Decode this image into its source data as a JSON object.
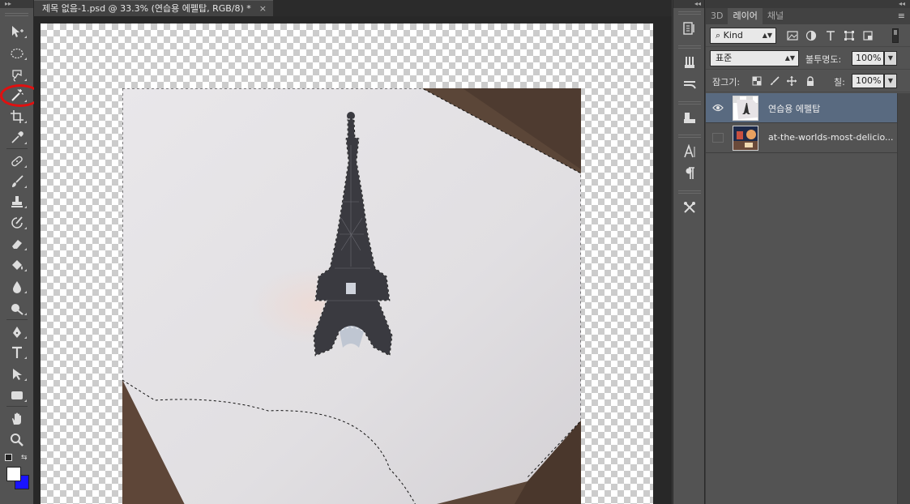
{
  "document": {
    "tab_title": "제목 없음-1.psd @ 33.3% (연습용 에펠탑, RGB/8) *",
    "close_glyph": "×"
  },
  "toolbar": {
    "collapse_glyph": "▸▸",
    "tools": [
      {
        "id": "move",
        "icon": "move-icon"
      },
      {
        "id": "marquee",
        "icon": "elliptical-marquee-icon"
      },
      {
        "id": "lasso",
        "icon": "lasso-icon"
      },
      {
        "id": "magic-wand",
        "icon": "magic-wand-icon",
        "highlighted": true,
        "highlight_color": "#e01010"
      },
      {
        "id": "crop",
        "icon": "crop-icon"
      },
      {
        "id": "eyedropper",
        "icon": "eyedropper-icon"
      },
      {
        "id": "healing",
        "icon": "healing-brush-icon"
      },
      {
        "id": "brush",
        "icon": "brush-icon"
      },
      {
        "id": "stamp",
        "icon": "clone-stamp-icon"
      },
      {
        "id": "history-brush",
        "icon": "history-brush-icon"
      },
      {
        "id": "eraser",
        "icon": "eraser-icon"
      },
      {
        "id": "paint-bucket",
        "icon": "paint-bucket-icon"
      },
      {
        "id": "blur",
        "icon": "blur-icon"
      },
      {
        "id": "dodge",
        "icon": "dodge-icon"
      },
      {
        "id": "pen",
        "icon": "pen-icon"
      },
      {
        "id": "type",
        "icon": "type-icon"
      },
      {
        "id": "path-select",
        "icon": "path-selection-icon"
      },
      {
        "id": "shape",
        "icon": "rectangle-shape-icon"
      },
      {
        "id": "hand",
        "icon": "hand-icon"
      },
      {
        "id": "zoom",
        "icon": "zoom-icon"
      }
    ],
    "foreground_color": "#ffffff",
    "background_color": "#1a14ff"
  },
  "panel": {
    "collapse_glyph": "◂◂",
    "tabs": [
      "3D",
      "레이어",
      "채널"
    ],
    "active_tab": "레이어",
    "menu_glyph": "≡",
    "filter_kind": "Kind",
    "blend_mode": "표준",
    "opacity_label": "불투명도:",
    "opacity_value": "100%",
    "lock_label": "잠그기:",
    "fill_label": "칠:",
    "fill_value": "100%",
    "layers": [
      {
        "name": "연습용 에펠탑",
        "visible": true,
        "selected": true
      },
      {
        "name": "at-the-worlds-most-delicio...",
        "visible": false,
        "selected": false
      }
    ]
  },
  "colors": {
    "selection_highlight": "#596a80",
    "annotation_ring": "#e01010",
    "app_bg": "#535353"
  }
}
